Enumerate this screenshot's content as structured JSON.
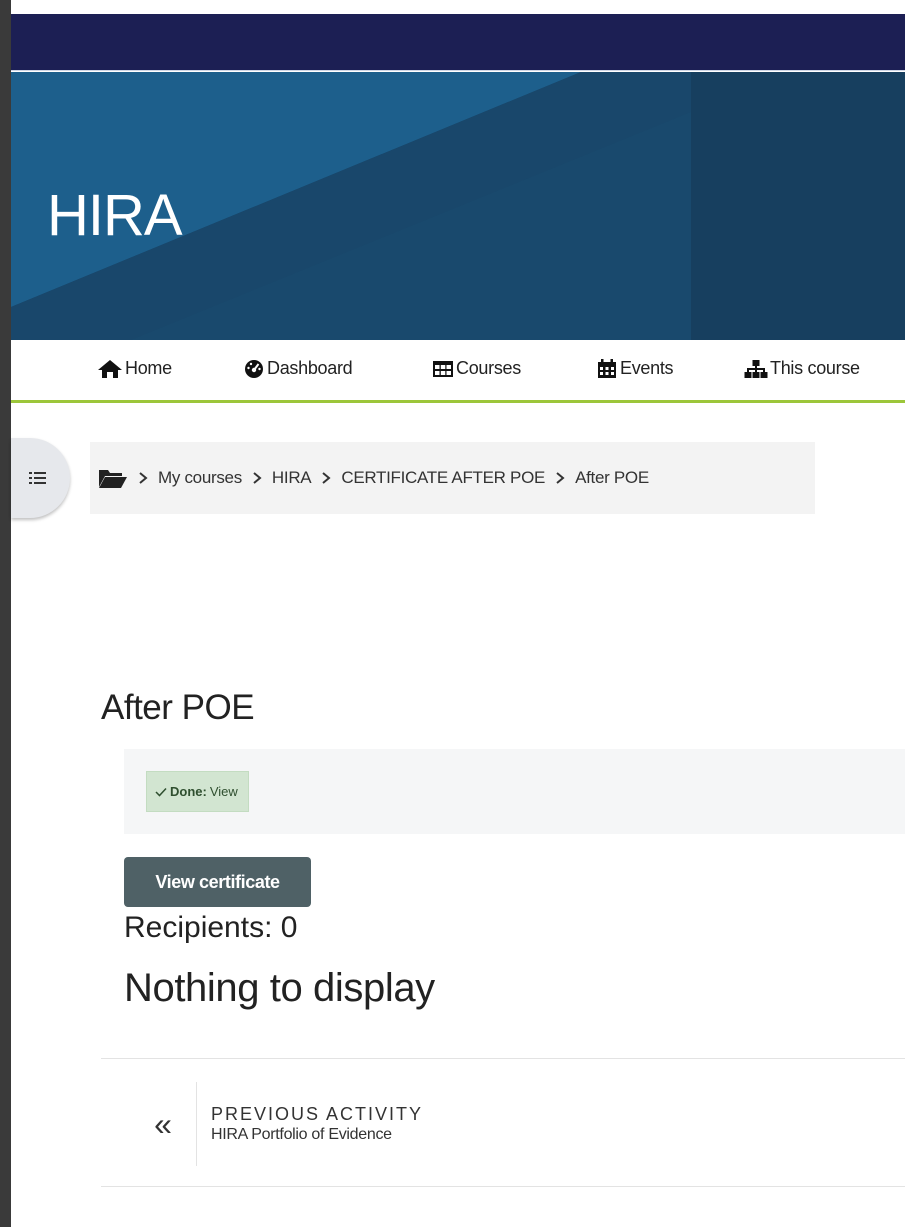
{
  "banner": {
    "title": "HIRA"
  },
  "nav": {
    "items": [
      {
        "label": "Home",
        "icon": "home-icon"
      },
      {
        "label": "Dashboard",
        "icon": "dashboard-icon"
      },
      {
        "label": "Courses",
        "icon": "table-icon"
      },
      {
        "label": "Events",
        "icon": "calendar-icon"
      },
      {
        "label": "This course",
        "icon": "sitemap-icon"
      }
    ]
  },
  "breadcrumb": {
    "items": [
      "My courses",
      "HIRA",
      "CERTIFICATE AFTER POE",
      "After POE"
    ]
  },
  "page": {
    "title": "After POE",
    "completion": {
      "done_label": "Done:",
      "done_value": "View"
    },
    "view_certificate_label": "View certificate",
    "recipients": "Recipients: 0",
    "empty_message": "Nothing to display"
  },
  "activity_nav": {
    "previous_label": "PREVIOUS ACTIVITY",
    "previous_name": "HIRA Portfolio of Evidence",
    "arrow": "«"
  },
  "colors": {
    "topbar": "#1c1f54",
    "banner": "#163e5e",
    "nav_accent": "#9cc63a",
    "button": "#4f6166",
    "done_badge": "#d2e5d1"
  }
}
